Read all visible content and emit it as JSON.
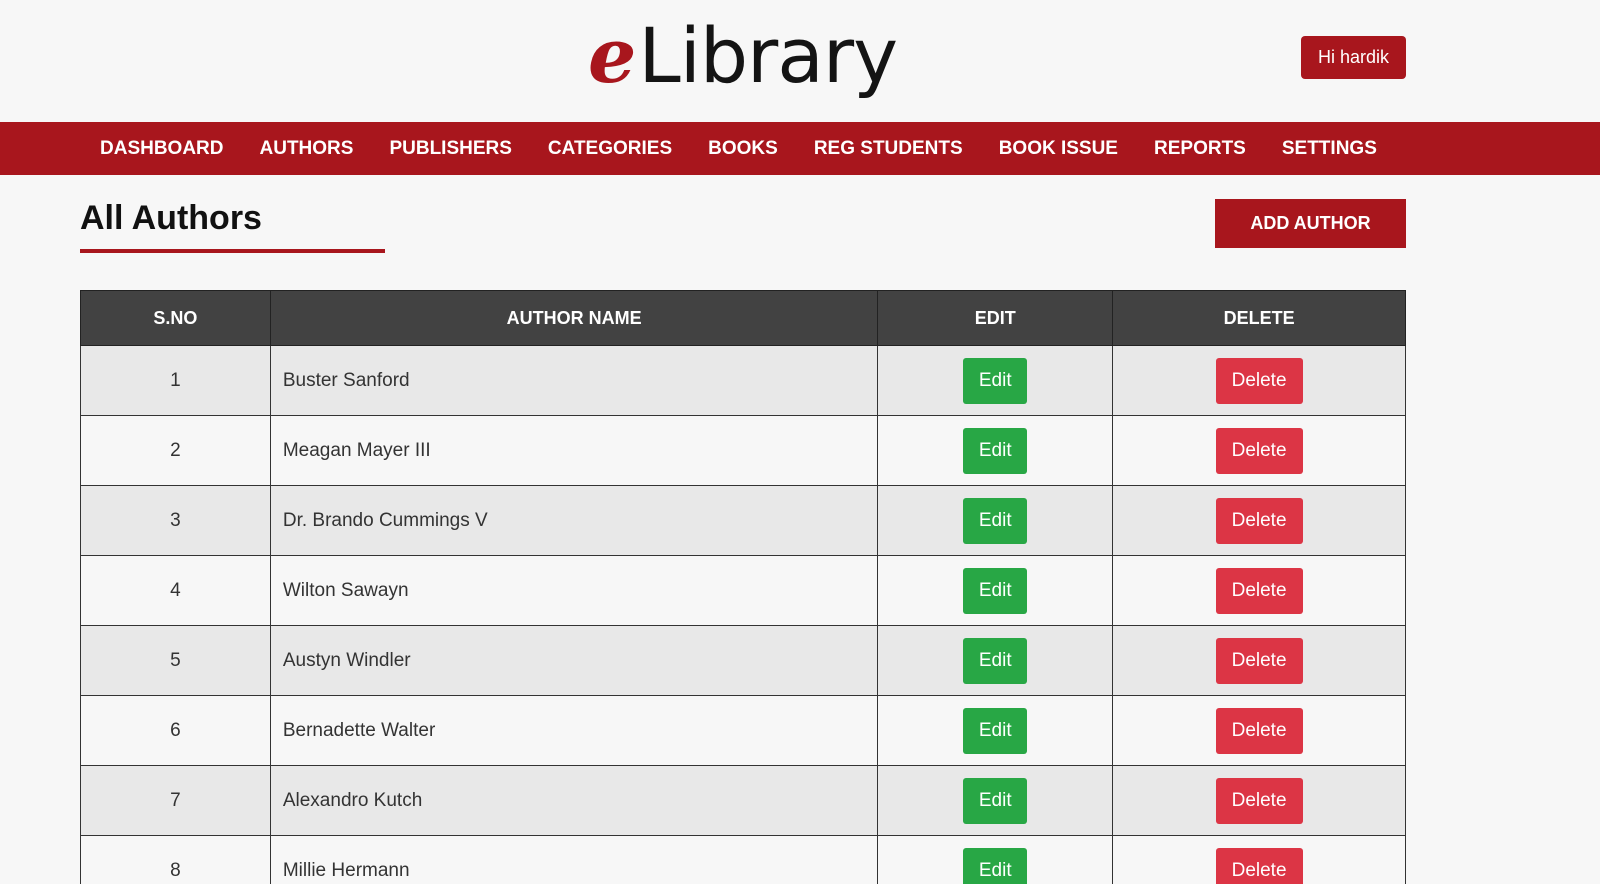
{
  "header": {
    "logo_prefix": "e",
    "logo_text": "Library",
    "user_greeting": "Hi hardik"
  },
  "nav": {
    "items": [
      {
        "label": "DASHBOARD"
      },
      {
        "label": "AUTHORS"
      },
      {
        "label": "PUBLISHERS"
      },
      {
        "label": "CATEGORIES"
      },
      {
        "label": "BOOKS"
      },
      {
        "label": "REG STUDENTS"
      },
      {
        "label": "BOOK ISSUE"
      },
      {
        "label": "REPORTS"
      },
      {
        "label": "SETTINGS"
      }
    ]
  },
  "main": {
    "title": "All Authors",
    "add_button_label": "ADD AUTHOR",
    "table": {
      "columns": [
        "S.NO",
        "AUTHOR NAME",
        "EDIT",
        "DELETE"
      ],
      "edit_label": "Edit",
      "delete_label": "Delete",
      "rows": [
        {
          "sno": "1",
          "name": "Buster Sanford"
        },
        {
          "sno": "2",
          "name": "Meagan Mayer III"
        },
        {
          "sno": "3",
          "name": "Dr. Brando Cummings V"
        },
        {
          "sno": "4",
          "name": "Wilton Sawayn"
        },
        {
          "sno": "5",
          "name": "Austyn Windler"
        },
        {
          "sno": "6",
          "name": "Bernadette Walter"
        },
        {
          "sno": "7",
          "name": "Alexandro Kutch"
        },
        {
          "sno": "8",
          "name": "Millie Hermann"
        }
      ]
    }
  },
  "colors": {
    "brand": "#a8161d",
    "table_header": "#424242",
    "edit": "#28a745",
    "delete": "#dc3545"
  }
}
